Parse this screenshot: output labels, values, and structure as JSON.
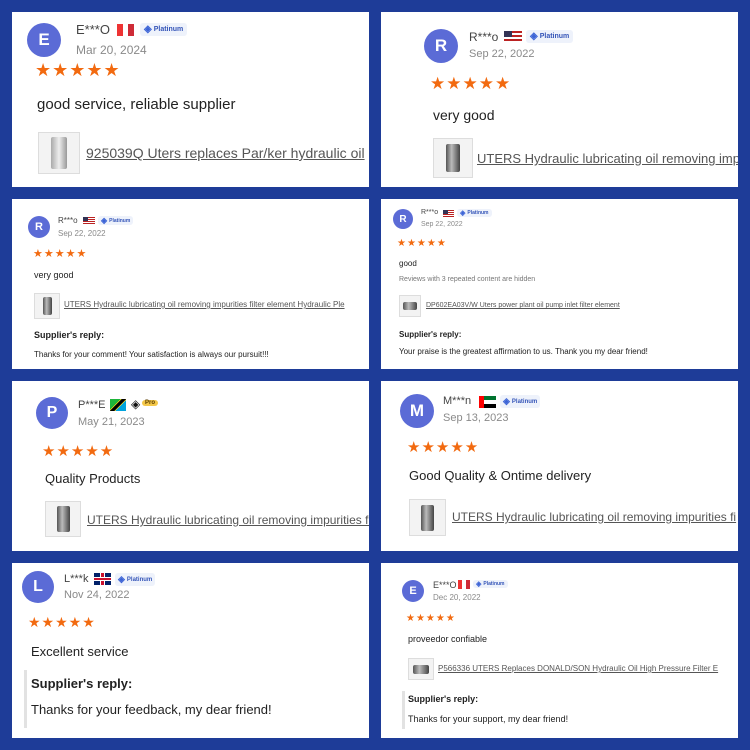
{
  "reviews": [
    {
      "initial": "E",
      "name": "E***O",
      "date": "Mar 20, 2024",
      "stars": "★★★★★",
      "badge": "Platinum",
      "flag": "Italy",
      "text": "good service, reliable supplier",
      "product": "925039Q Uters replaces Par/ker hydraulic oil"
    },
    {
      "initial": "R",
      "name": "R***o",
      "date": "Sep 22, 2022",
      "stars": "★★★★★",
      "badge": "Platinum",
      "flag": "United States",
      "text": "very good",
      "product": "UTERS Hydraulic lubricating oil removing impu"
    },
    {
      "initial": "R",
      "name": "R***o",
      "date": "Sep 22, 2022",
      "stars": "★★★★★",
      "badge": "Platinum",
      "flag": "United States",
      "text": "very good",
      "product": "UTERS Hydraulic lubricating oil removing impurities filter element Hydraulic Ple",
      "reply_title": "Supplier's reply:",
      "reply": "Thanks for your comment! Your satisfaction is always our pursuit!!!"
    },
    {
      "initial": "R",
      "name": "R***o",
      "date": "Sep 22, 2022",
      "stars": "★★★★★",
      "badge": "Platinum",
      "flag": "United States",
      "text": "good",
      "note": "Reviews with 3 repeated content are hidden",
      "product": "DP602EA03V/W Uters power plant oil pump inlet filter element",
      "reply_title": "Supplier's reply:",
      "reply": "Your praise is the greatest affirmation to us. Thank you my dear friend!"
    },
    {
      "initial": "P",
      "name": "P***E",
      "date": "May 21, 2023",
      "stars": "★★★★★",
      "badge": "Pro",
      "flag": "Tanzania",
      "text": "Quality Products",
      "product": "UTERS Hydraulic lubricating oil removing impurities fil"
    },
    {
      "initial": "M",
      "name": "M***n",
      "date": "Sep 13, 2023",
      "stars": "★★★★★",
      "badge": "Platinum",
      "flag": "United Arab Emirates",
      "text": "Good Quality & Ontime delivery",
      "product": "UTERS Hydraulic lubricating oil removing impurities fi"
    },
    {
      "initial": "L",
      "name": "L***k",
      "date": "Nov 24, 2022",
      "stars": "★★★★★",
      "badge": "Platinum",
      "flag": "United Kingdom",
      "text": "Excellent service",
      "reply_title": "Supplier's reply:",
      "reply": "Thanks for your feedback, my dear friend!"
    },
    {
      "initial": "E",
      "name": "E***O",
      "date": "Dec 20, 2022",
      "stars": "★★★★★",
      "badge": "Platinum",
      "flag": "Italy",
      "text": "proveedor confiable",
      "product": "P566336 UTERS Replaces DONALD/SON Hydraulic Oil High Pressure Filter E",
      "reply_title": "Supplier's reply:",
      "reply": "Thanks for your support, my dear friend!"
    }
  ],
  "colors": {
    "background": "#1e3c98",
    "stars": "#f26a10",
    "avatar": "#5b6bd6"
  }
}
